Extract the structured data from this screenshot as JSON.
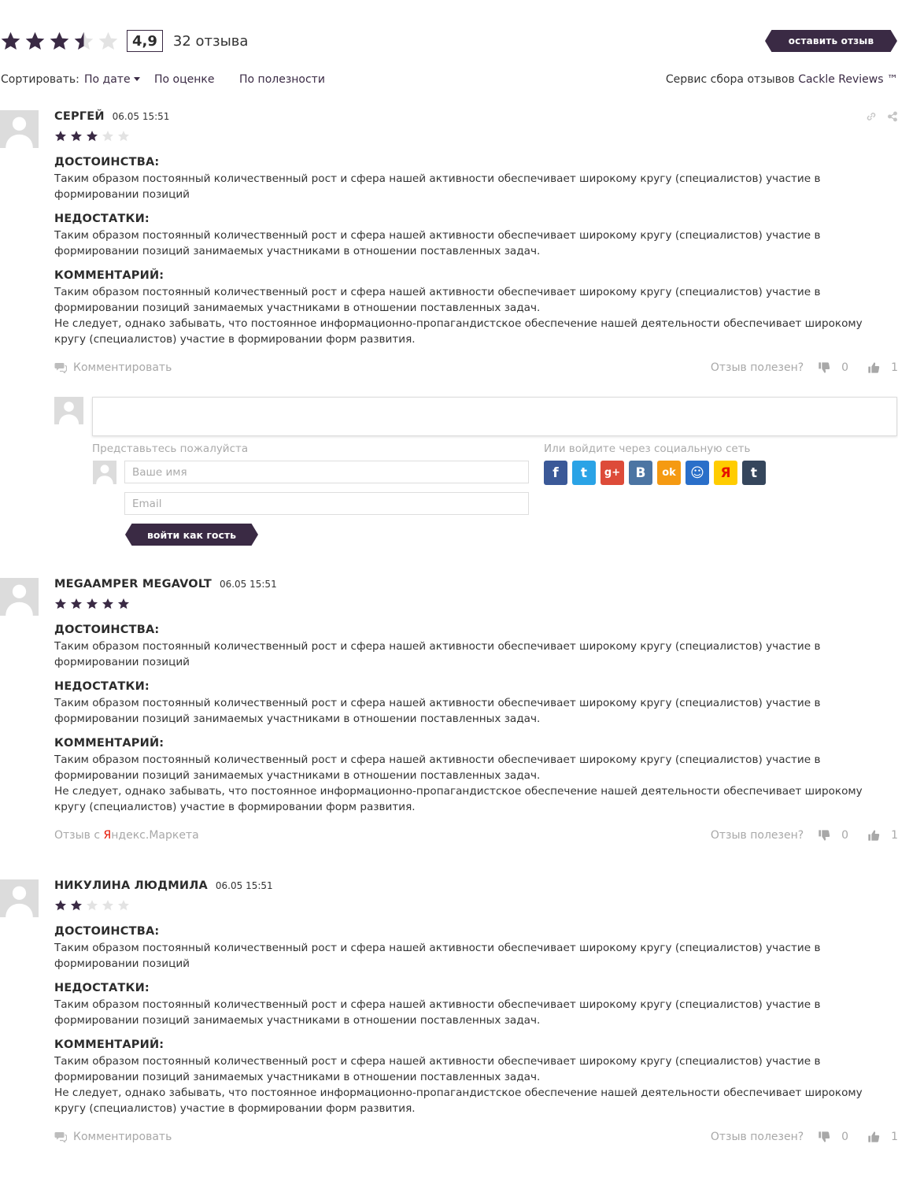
{
  "summary": {
    "rating_value": 3.5,
    "score": "4,9",
    "count": "32 отзыва",
    "leave_button": "оставить отзыв"
  },
  "sort": {
    "label": "Сортировать:",
    "options": [
      "По дате",
      "По оценке",
      "По полезности"
    ],
    "active": "По дате",
    "service_prefix": "Сервис сбора отзывов",
    "service_brand": "Cackle Reviews ™"
  },
  "labels": {
    "pros": "ДОСТОИНСТВА:",
    "cons": "НЕДОСТАТКИ:",
    "comment": "КОММЕНТАРИЙ:",
    "reply": "Комментировать",
    "useful": "Отзыв полезен?",
    "source_prefix": "Отзыв с ",
    "source_ya_letter": "Я",
    "source_rest": "ндекс.Маркета"
  },
  "reviews": [
    {
      "name": "СЕРГЕЙ",
      "date": "06.05 15:51",
      "stars": 3,
      "pros": "Таким образом постоянный количественный рост и сфера нашей активности обеспечивает широкому кругу (специалистов) участие в формировании позиций",
      "cons": "Таким образом постоянный количественный рост и сфера нашей активности обеспечивает широкому кругу (специалистов) участие в формировании позиций занимаемых участниками в отношении поставленных задач.",
      "comment_1": "Таким образом постоянный количественный рост и сфера нашей активности обеспечивает широкому кругу (специалистов) участие в формировании позиций занимаемых участниками в отношении поставленных задач.",
      "comment_2": "Не следует, однако забывать, что постоянное информационно-пропагандистское обеспечение нашей деятельности обеспечивает широкому кругу (специалистов) участие в формировании форм развития.",
      "votes_down": "0",
      "votes_up": "1"
    },
    {
      "name": "MEGAAMPER MEGAVOLT",
      "date": "06.05 15:51",
      "stars": 5,
      "pros": "Таким образом постоянный количественный рост и сфера нашей активности обеспечивает широкому кругу (специалистов) участие в формировании позиций",
      "cons": "Таким образом постоянный количественный рост и сфера нашей активности обеспечивает широкому кругу (специалистов) участие в формировании позиций занимаемых участниками в отношении поставленных задач.",
      "comment_1": "Таким образом постоянный количественный рост и сфера нашей активности обеспечивает широкому кругу (специалистов) участие в формировании позиций занимаемых участниками в отношении поставленных задач.",
      "comment_2": "Не следует, однако забывать, что постоянное информационно-пропагандистское обеспечение нашей деятельности обеспечивает широкому кругу (специалистов) участие в формировании форм развития.",
      "votes_down": "0",
      "votes_up": "1"
    },
    {
      "name": "НИКУЛИНА ЛЮДМИЛА",
      "date": "06.05 15:51",
      "stars": 2,
      "pros": "Таким образом постоянный количественный рост и сфера нашей активности обеспечивает широкому кругу (специалистов) участие в формировании позиций",
      "cons": "Таким образом постоянный количественный рост и сфера нашей активности обеспечивает широкому кругу (специалистов) участие в формировании позиций занимаемых участниками в отношении поставленных задач.",
      "comment_1": "Таким образом постоянный количественный рост и сфера нашей активности обеспечивает широкому кругу (специалистов) участие в формировании позиций занимаемых участниками в отношении поставленных задач.",
      "comment_2": "Не следует, однако забывать, что постоянное информационно-пропагандистское обеспечение нашей деятельности обеспечивает широкому кругу (специалистов) участие в формировании форм развития.",
      "votes_down": "0",
      "votes_up": "1"
    }
  ],
  "comment_form": {
    "intro": "Представьтесь пожалуйста",
    "social_intro": "Или войдите через социальную сеть",
    "name_placeholder": "Ваше имя",
    "email_placeholder": "Email",
    "guest_button": "войти как гость",
    "socials": [
      {
        "icon": "facebook-icon",
        "glyph": "f",
        "color": "#3b5998"
      },
      {
        "icon": "twitter-icon",
        "glyph": "t",
        "color": "#2aa3e6"
      },
      {
        "icon": "google-plus-icon",
        "glyph": "g+",
        "color": "#dd4b39"
      },
      {
        "icon": "vk-icon",
        "glyph": "B",
        "color": "#4c75a3"
      },
      {
        "icon": "odnoklassniki-icon",
        "glyph": "ok",
        "color": "#f59a12"
      },
      {
        "icon": "mailru-icon",
        "glyph": "☺",
        "color": "#2a6fc9"
      },
      {
        "icon": "yandex-icon",
        "glyph": "Я",
        "color": "#ffcc00"
      },
      {
        "icon": "tumblr-icon",
        "glyph": "t",
        "color": "#35465c"
      }
    ]
  }
}
